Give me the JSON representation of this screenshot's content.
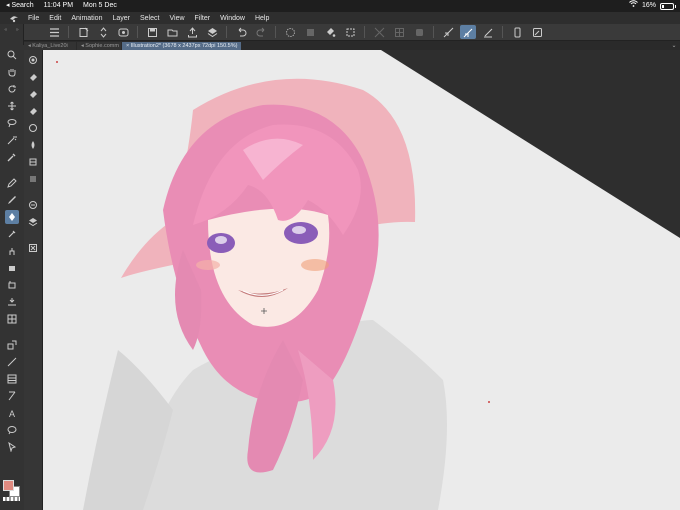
{
  "status_bar": {
    "back_app": "◂ Search",
    "time": "11:04 PM",
    "date": "Mon 5 Dec",
    "battery": "16%",
    "battery_level": 0.16
  },
  "menu": {
    "items": [
      "File",
      "Edit",
      "Animation",
      "Layer",
      "Select",
      "View",
      "Filter",
      "Window",
      "Help"
    ]
  },
  "command_bar": {
    "buttons": [
      "menu-icon",
      "new-icon",
      "up-down-icon",
      "fx-icon",
      "save-icon",
      "open-icon",
      "export-icon",
      "layers-icon",
      "undo-icon",
      "redo-icon",
      "select-lasso-icon",
      "transform-icon",
      "fill-icon",
      "crop-icon",
      "hide-icon",
      "grid-icon",
      "mask-icon",
      "ruler-icon",
      "pen-active-icon",
      "brush-icon",
      "smartphone-icon",
      "edit-icon"
    ]
  },
  "tabs": [
    {
      "label": "Kaliya_Live20i",
      "active": false
    },
    {
      "label": "Sophie.comm",
      "active": false
    },
    {
      "label": "Illustration2* (3678 x 2437px 72dpi 150.5%)",
      "active": true
    }
  ],
  "tools_col1": [
    "zoom-icon",
    "hand-icon",
    "rotate-icon",
    "move-icon",
    "lasso-icon",
    "magic-wand-icon",
    "eyedropper-icon",
    "pen-icon",
    "pencil-icon",
    "brush-icon",
    "airbrush-icon",
    "decoration-icon",
    "eraser-icon",
    "blend-icon",
    "fill-icon",
    "gradient-icon",
    "shape-icon",
    "frame-icon",
    "ruler-icon",
    "text-icon",
    "balloon-icon",
    "correct-line-icon"
  ],
  "tools_col2": [
    "sub-tool-1",
    "sub-tool-2",
    "sub-tool-3",
    "sub-tool-4",
    "sub-tool-5",
    "sub-tool-6",
    "sub-tool-7",
    "sub-tool-8",
    "sub-tool-9",
    "sub-tool-10",
    "sub-tool-11"
  ],
  "colors": {
    "main": "#e08a80",
    "sub": "#ffffff",
    "accent": "#5d7fa3",
    "hair": "#e88fb4",
    "hat": "#f2b8c0"
  }
}
